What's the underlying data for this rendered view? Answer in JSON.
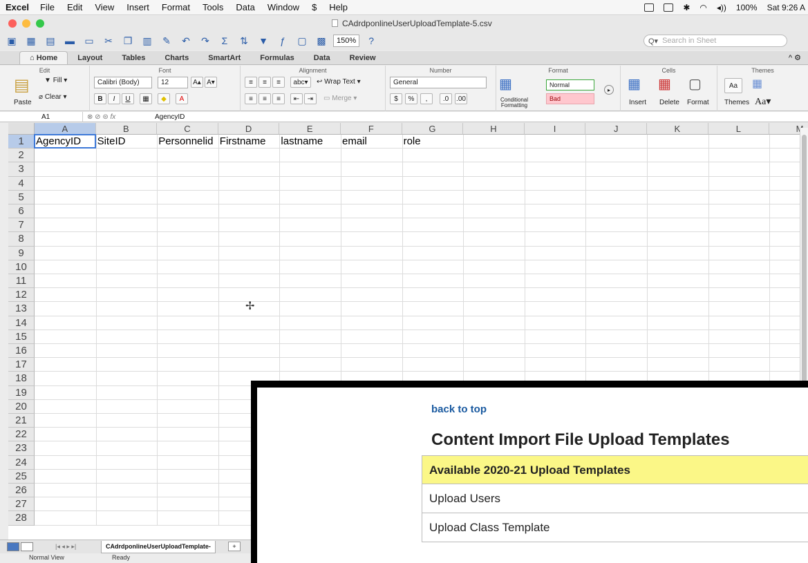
{
  "menubar": {
    "app": "Excel",
    "items": [
      "File",
      "Edit",
      "View",
      "Insert",
      "Format",
      "Tools",
      "Data",
      "Window",
      "Help"
    ],
    "battery": "100%",
    "clock": "Sat 9:26 A"
  },
  "window": {
    "title": "CAdrdponlineUserUploadTemplate-5.csv"
  },
  "toolbar": {
    "zoom": "150%",
    "search_placeholder": "Search in Sheet"
  },
  "ribbon": {
    "tabs": [
      "Home",
      "Layout",
      "Tables",
      "Charts",
      "SmartArt",
      "Formulas",
      "Data",
      "Review"
    ],
    "active_tab": "Home",
    "groups": {
      "edit": "Edit",
      "font": "Font",
      "alignment": "Alignment",
      "number": "Number",
      "format": "Format",
      "cells": "Cells",
      "themes": "Themes"
    },
    "fill_label": "Fill",
    "clear_label": "Clear",
    "paste_label": "Paste",
    "font_name": "Calibri (Body)",
    "font_size": "12",
    "wrap_text": "Wrap Text",
    "merge": "Merge",
    "number_format": "General",
    "conditional_formatting": "Conditional Formatting",
    "style_normal": "Normal",
    "style_bad": "Bad",
    "insert": "Insert",
    "delete": "Delete",
    "format": "Format",
    "themes": "Themes",
    "abc": "abc"
  },
  "formula_bar": {
    "name_box": "A1",
    "value": "AgencyID"
  },
  "sheet": {
    "columns": [
      "A",
      "B",
      "C",
      "D",
      "E",
      "F",
      "G",
      "H",
      "I",
      "J",
      "K",
      "L",
      "M"
    ],
    "rows": [
      "1",
      "2",
      "3",
      "4",
      "5",
      "6",
      "7",
      "8",
      "9",
      "10",
      "11",
      "12",
      "13",
      "14",
      "15",
      "16",
      "17",
      "18",
      "19",
      "20",
      "21",
      "22",
      "23",
      "24",
      "25",
      "26",
      "27",
      "28"
    ],
    "row1": [
      "AgencyID",
      "SiteID",
      "Personnelid",
      "Firstname",
      "lastname",
      "email",
      "role"
    ]
  },
  "sheetbar": {
    "tab_name": "CAdrdponlineUserUploadTemplate-",
    "view_label": "Normal View",
    "status": "Ready"
  },
  "overlay": {
    "back_link": "back to top",
    "title": "Content Import File Upload Templates",
    "table_rows": [
      "Available 2020-21 Upload Templates",
      "Upload Users",
      "Upload Class Template"
    ]
  }
}
